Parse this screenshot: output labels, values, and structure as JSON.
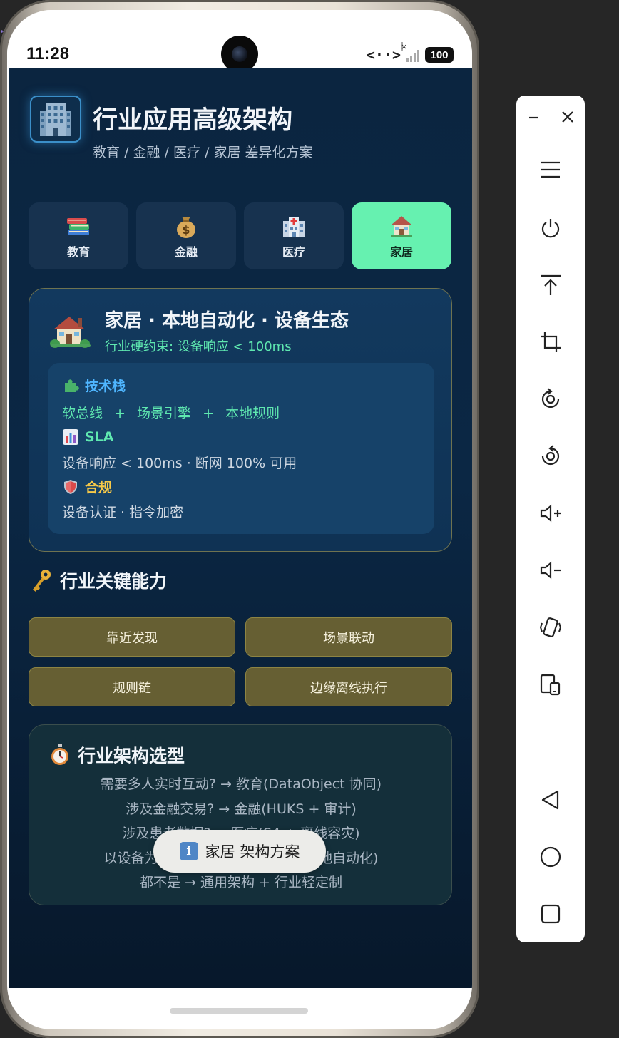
{
  "status_bar": {
    "time": "11:28",
    "battery": "100",
    "network_label": "<··>",
    "signal_x": "×"
  },
  "header": {
    "title": "行业应用高级架构",
    "subtitle": "教育 / 金融 / 医疗 / 家居 差异化方案",
    "logo_icon": "office-building-icon"
  },
  "tabs": [
    {
      "label": "教育",
      "icon": "books-icon",
      "active": false
    },
    {
      "label": "金融",
      "icon": "money-bag-icon",
      "active": false
    },
    {
      "label": "医疗",
      "icon": "hospital-icon",
      "active": false
    },
    {
      "label": "家居",
      "icon": "house-icon",
      "active": true
    }
  ],
  "industry": {
    "icon": "house-with-garden-icon",
    "title": "家居 · 本地自动化 · 设备生态",
    "constraint": "行业硬约束: 设备响应 < 100ms",
    "tech_stack": {
      "heading": "技术栈",
      "items": [
        "软总线",
        "场景引擎",
        "本地规则"
      ],
      "separator": "+"
    },
    "sla": {
      "heading": "SLA",
      "text": "设备响应 < 100ms · 断网 100% 可用"
    },
    "compliance": {
      "heading": "合规",
      "text": "设备认证 · 指令加密"
    }
  },
  "capabilities": {
    "title": "行业关键能力",
    "items": [
      "靠近发现",
      "场景联动",
      "规则链",
      "边缘离线执行"
    ]
  },
  "selection": {
    "title": "行业架构选型",
    "lines": [
      "需要多人实时互动? → 教育(DataObject 协同)",
      "涉及金融交易? → 金融(HUKS + 审计)",
      "涉及患者数据? → 医疗(S4 + 离线容灾)",
      "以设备为中心? → 家居(软总线 + 本地自动化)",
      "都不是 → 通用架构 + 行业轻定制"
    ]
  },
  "toast": {
    "text": "家居 架构方案",
    "icon": "info-icon",
    "icon_glyph": "i"
  },
  "colors": {
    "app_bg": "#0b2540",
    "tab_active": "#66f1b0",
    "accent_green": "#5fe8b0",
    "accent_blue": "#4fb6ff",
    "accent_yellow": "#f7c948",
    "capability_bg": "#665f33"
  }
}
